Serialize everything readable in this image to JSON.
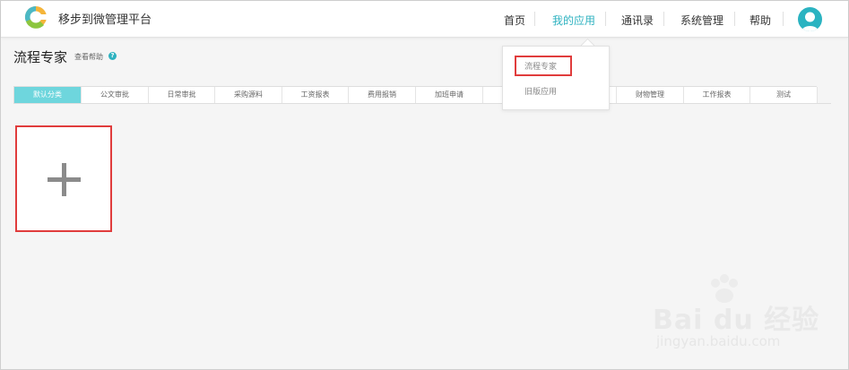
{
  "brand": {
    "name": "移步到微管理平台",
    "logo_icon": "app-logo-icon"
  },
  "nav": {
    "items": [
      {
        "label": "首页",
        "active": false
      },
      {
        "label": "我的应用",
        "active": true
      },
      {
        "label": "通讯录",
        "active": false
      },
      {
        "label": "系统管理",
        "active": false
      },
      {
        "label": "帮助",
        "active": false
      }
    ],
    "avatar_icon": "user-avatar-icon"
  },
  "page": {
    "title": "流程专家",
    "help_link": "查看帮助",
    "help_icon": "question-icon"
  },
  "tabs": [
    "默认分类",
    "公文审批",
    "日常审批",
    "采购源料",
    "工资报表",
    "费用报销",
    "加班申请",
    "",
    "",
    "",
    "",
    "财物管理",
    "工作报表",
    "测试"
  ],
  "add_card": {
    "icon": "plus-icon"
  },
  "dropdown": {
    "items": [
      "流程专家",
      "旧版应用"
    ]
  },
  "watermark": {
    "main": "Bai du 经验",
    "sub": "jingyan.baidu.com"
  },
  "colors": {
    "accent": "#2eb2c0",
    "active_tab": "#6ed6dd",
    "highlight": "#e03c3c"
  }
}
